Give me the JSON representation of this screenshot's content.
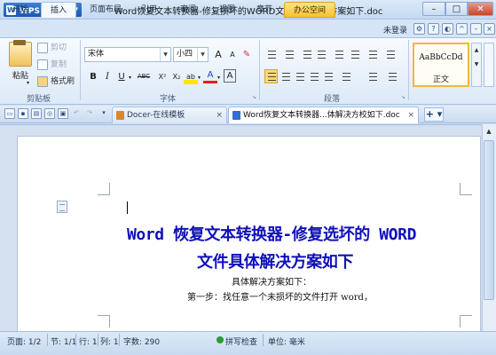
{
  "window": {
    "app_menu_label": "WPS 文字",
    "logo_letter": "W",
    "title": "Word恢复文本转换器-修复损坏的WORD文件具体解决方案如下.doc",
    "min": "–",
    "max": "□",
    "close": "✕"
  },
  "ribbon_tabs": [
    "开始",
    "插入",
    "页面布局",
    "引用",
    "审阅",
    "视图",
    "章节",
    "办公空间"
  ],
  "login_text": "未登录",
  "clipboard": {
    "paste": "粘贴",
    "cut": "剪切",
    "copy": "复制",
    "format_painter": "格式刷",
    "group_label": "剪贴板"
  },
  "font": {
    "font_name": "宋体",
    "font_size": "小四",
    "grow": "A",
    "shrink": "A",
    "bold": "B",
    "italic": "I",
    "underline": "U",
    "strike": "ABC",
    "sup": "X²",
    "sub": "X₂",
    "highlight": "ab",
    "font_color": "A",
    "char_border": "A",
    "group_label": "字体"
  },
  "paragraph": {
    "group_label": "段落"
  },
  "styles": {
    "sample": "AaBbCcDd",
    "name": "正文"
  },
  "doc_tabs": [
    {
      "label": "Docer-在线模板",
      "close": "×"
    },
    {
      "label": "Word恢复文本转换器...体解决方校如下.doc",
      "close": "×"
    }
  ],
  "add_tab": "+ ▾",
  "document": {
    "heading_line1": "Word 恢复文本转换器-修复选坏的 WORD",
    "heading_line2": "文件具体解决方案如下",
    "para1": "具体解决方案如下：",
    "para2": "第一步：找任意一个未损坏的文件打开 word，"
  },
  "status": {
    "page": "页面: 1/2",
    "section": "节: 1/1",
    "line": "行: 1",
    "column": "列: 1",
    "word_count": "字数: 290",
    "spell_check": "拼写检查",
    "unit": "单位: 毫米"
  },
  "colors": {
    "accent": "#1d58b0",
    "heading": "#1010b8",
    "office_tab": "#f6c22c"
  }
}
